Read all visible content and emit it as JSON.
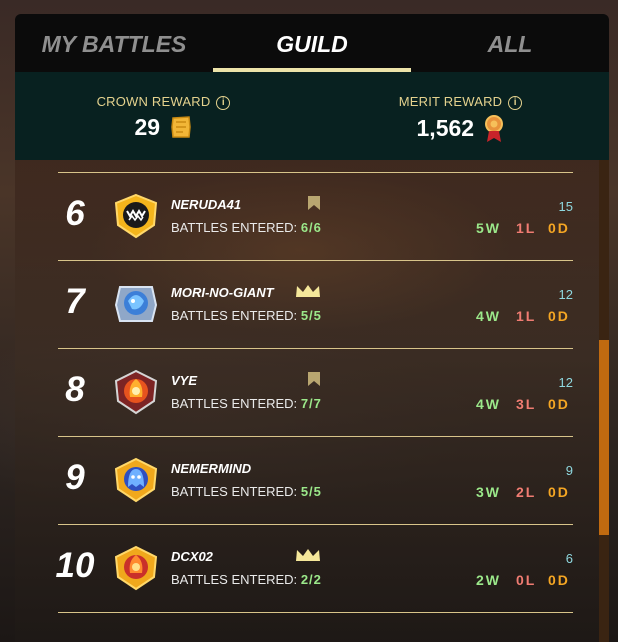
{
  "tabs": [
    {
      "label": "MY BATTLES",
      "active": false
    },
    {
      "label": "GUILD",
      "active": true
    },
    {
      "label": "ALL",
      "active": false
    }
  ],
  "rewards": {
    "crown": {
      "label": "CROWN REWARD",
      "value": "29",
      "icon": "crown-token-icon"
    },
    "merit": {
      "label": "MERIT REWARD",
      "value": "1,562",
      "icon": "merit-medal-icon"
    }
  },
  "entered_label": "BATTLES ENTERED:",
  "colors": {
    "win": "#9be88a",
    "loss": "#f07c72",
    "draw": "#f5a623",
    "score": "#8fd8df",
    "accent": "#ece3a9"
  },
  "rows": [
    {
      "rank": "6",
      "name": "NERUDA41",
      "entered": "6/6",
      "score": "15",
      "w": "5W",
      "l": "1L",
      "d": "0D",
      "badge": "bookmark-icon",
      "avatar": "monster-mouth-avatar"
    },
    {
      "rank": "7",
      "name": "MORI-NO-GIANT",
      "entered": "5/5",
      "score": "12",
      "w": "4W",
      "l": "1L",
      "d": "0D",
      "badge": "crown-icon",
      "avatar": "blue-creature-avatar"
    },
    {
      "rank": "8",
      "name": "VYE",
      "entered": "7/7",
      "score": "12",
      "w": "4W",
      "l": "3L",
      "d": "0D",
      "badge": "bookmark-icon",
      "avatar": "fire-spirit-avatar"
    },
    {
      "rank": "9",
      "name": "NEMERMIND",
      "entered": "5/5",
      "score": "9",
      "w": "3W",
      "l": "2L",
      "d": "0D",
      "badge": "",
      "avatar": "blue-ghost-avatar"
    },
    {
      "rank": "10",
      "name": "DCX02",
      "entered": "2/2",
      "score": "6",
      "w": "2W",
      "l": "0L",
      "d": "0D",
      "badge": "crown-icon",
      "avatar": "fire-spirit-avatar"
    }
  ]
}
